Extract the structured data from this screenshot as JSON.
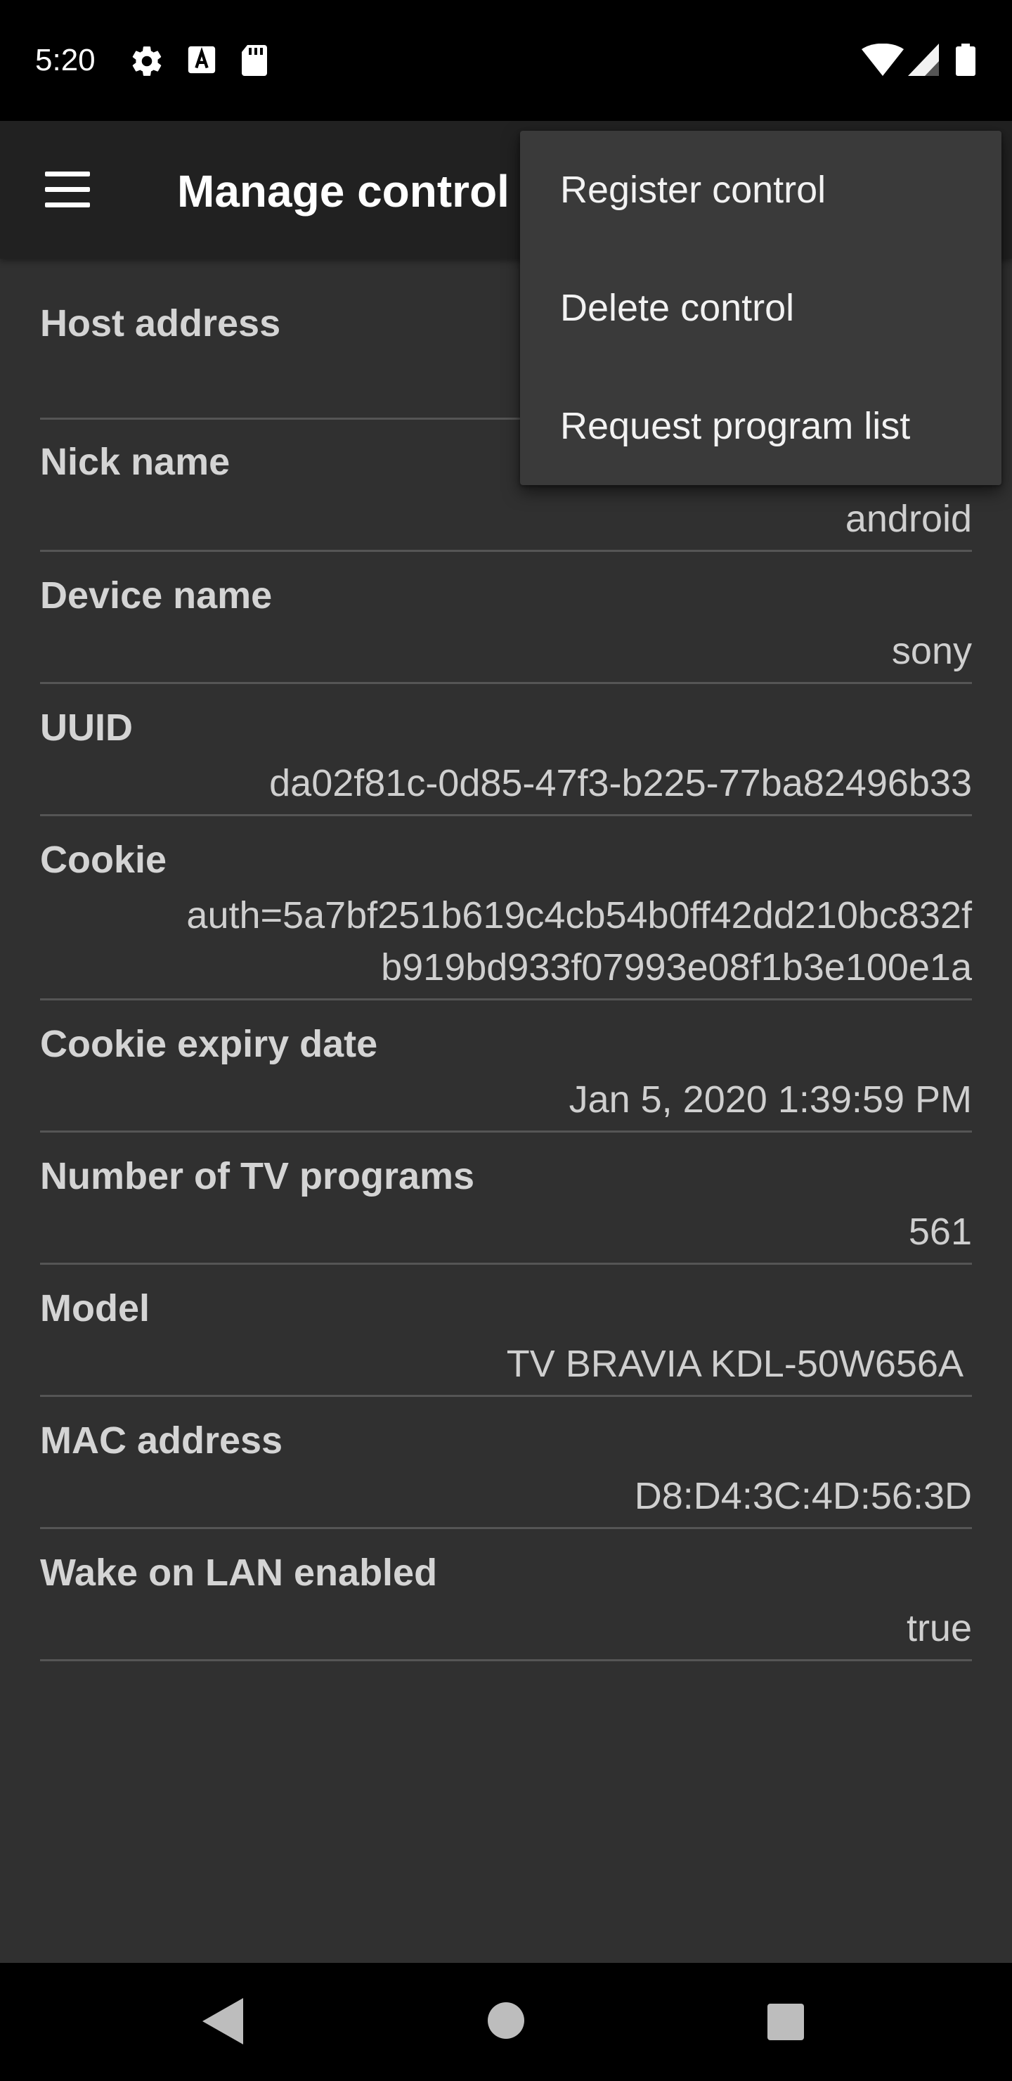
{
  "status_bar": {
    "time": "5:20",
    "left_icons": [
      "gear-icon",
      "a-icon",
      "sd-card-icon"
    ],
    "right_icons": [
      "wifi-icon",
      "signal-icon",
      "battery-icon"
    ]
  },
  "app_bar": {
    "title": "Manage control",
    "menu_icon": "hamburger-icon"
  },
  "fields": [
    {
      "label": "Host address",
      "value": ""
    },
    {
      "label": "Nick name",
      "value": "android"
    },
    {
      "label": "Device name",
      "value": "sony"
    },
    {
      "label": "UUID",
      "value": "da02f81c-0d85-47f3-b225-77ba82496b33"
    },
    {
      "label": "Cookie",
      "value_line1": "auth=5a7bf251b619c4cb54b0ff42dd210bc832f",
      "value_line2": "b919bd933f07993e08f1b3e100e1a"
    },
    {
      "label": "Cookie expiry date",
      "value": "Jan 5, 2020 1:39:59 PM"
    },
    {
      "label": "Number of TV programs",
      "value": "561"
    },
    {
      "label": "Model",
      "value": "TV BRAVIA KDL-50W656A "
    },
    {
      "label": "MAC address",
      "value": "D8:D4:3C:4D:56:3D"
    },
    {
      "label": "Wake on LAN enabled",
      "value": "true"
    }
  ],
  "overflow_menu": {
    "items": [
      "Register control",
      "Delete control",
      "Request program list"
    ]
  },
  "nav_bar": {
    "buttons": [
      "back-icon",
      "home-icon",
      "recents-icon"
    ]
  },
  "colors": {
    "background": "#303030",
    "app_bar": "#212121",
    "menu": "#3a3a3a",
    "divider": "#555555"
  }
}
